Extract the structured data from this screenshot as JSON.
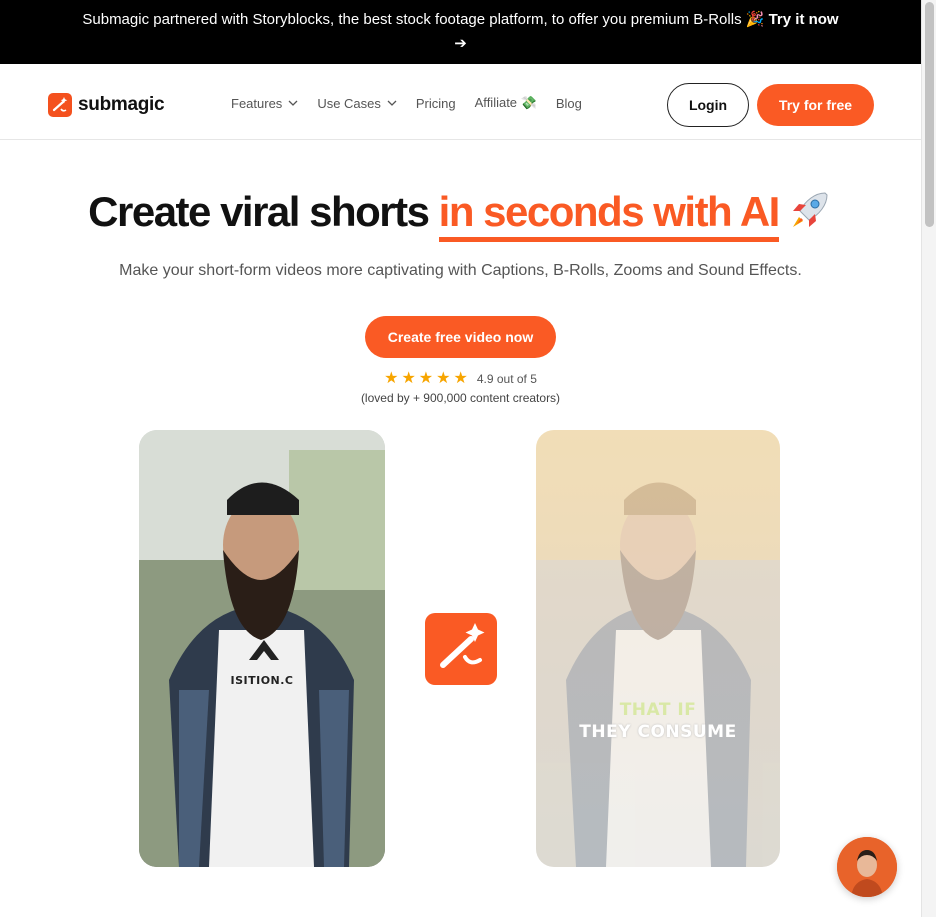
{
  "banner": {
    "text": "Submagic partnered with Storyblocks, the best stock footage platform, to offer you premium B-Rolls 🎉 ",
    "link_label": "Try it now ➔"
  },
  "nav": {
    "logo_text": "submagic",
    "items": [
      {
        "label": "Features",
        "has_dropdown": true
      },
      {
        "label": "Use Cases",
        "has_dropdown": true
      },
      {
        "label": "Pricing",
        "has_dropdown": false
      },
      {
        "label": "Affiliate 💸",
        "has_dropdown": false
      },
      {
        "label": "Blog",
        "has_dropdown": false
      }
    ],
    "login_label": "Login",
    "try_label": "Try for free"
  },
  "hero": {
    "title_plain": "Create viral shorts ",
    "title_highlight": "in seconds with AI",
    "subtitle": "Make your short-form videos more captivating with Captions, B-Rolls, Zooms and Sound Effects.",
    "cta_label": "Create free video now",
    "stars": 5,
    "rating_text": "4.9 out of 5",
    "loved_text": "(loved by + 900,000 content creators)"
  },
  "videos": {
    "right_caption_line1": "THAT IF",
    "right_caption_line2": "THEY CONSUME",
    "shirt_text": "ISITION.C"
  },
  "colors": {
    "accent": "#fa5a24",
    "banner_bg": "#000000",
    "star": "#f7a500"
  }
}
